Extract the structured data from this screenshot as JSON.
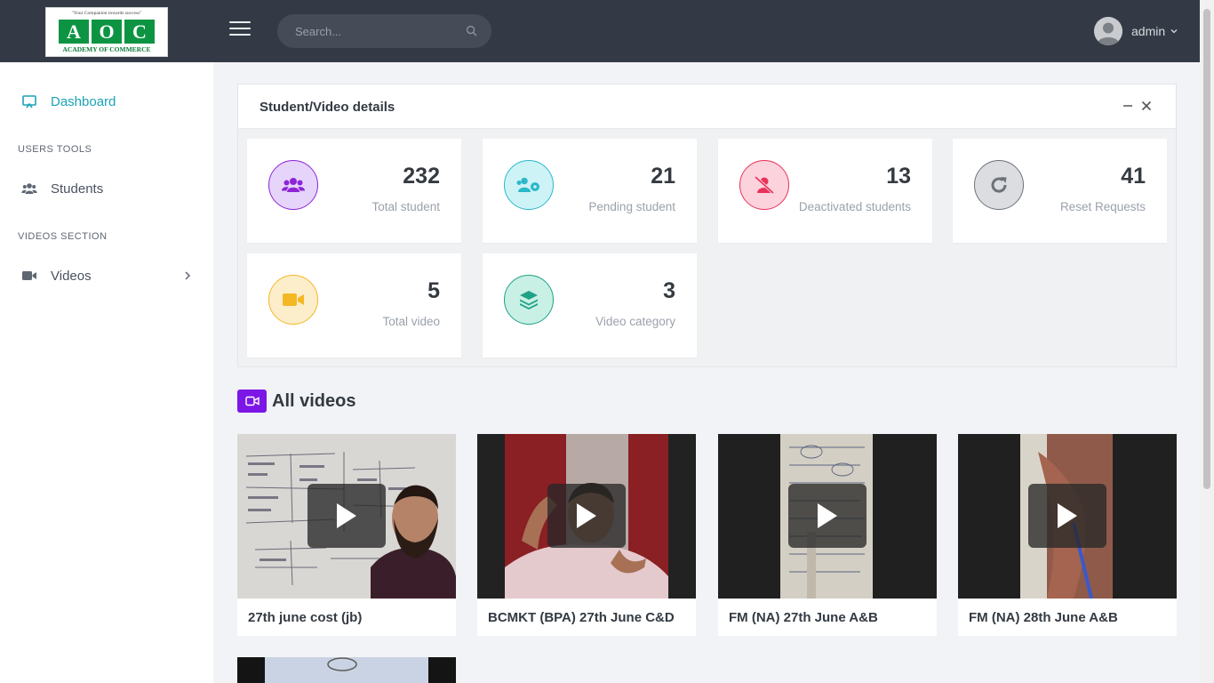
{
  "header": {
    "logo": {
      "tagline": "\"Your Companion towards success\"",
      "letters": [
        "A",
        "O",
        "C"
      ],
      "name": "ACADEMY OF COMMERCE"
    },
    "search_placeholder": "Search...",
    "user_name": "admin"
  },
  "sidebar": {
    "dashboard": "Dashboard",
    "section_users": "USERS TOOLS",
    "students": "Students",
    "section_videos": "VIDEOS SECTION",
    "videos": "Videos"
  },
  "panel": {
    "title": "Student/Video details",
    "cards": [
      {
        "value": "232",
        "label": "Total student",
        "icon": "users-icon",
        "color": "#8e24d6"
      },
      {
        "value": "21",
        "label": "Pending student",
        "icon": "users-cog-icon",
        "color": "#2bb8c9"
      },
      {
        "value": "13",
        "label": "Deactivated students",
        "icon": "user-slash-icon",
        "color": "#e8325b"
      },
      {
        "value": "41",
        "label": "Reset Requests",
        "icon": "refresh-icon",
        "color": "#6c727a"
      },
      {
        "value": "5",
        "label": "Total video",
        "icon": "video-icon",
        "color": "#f3b824"
      },
      {
        "value": "3",
        "label": "Video category",
        "icon": "layers-icon",
        "color": "#1fa287"
      }
    ]
  },
  "videos_section": {
    "title": "All videos",
    "items": [
      {
        "title": "27th june cost (jb)"
      },
      {
        "title": "BCMKT (BPA) 27th June C&D"
      },
      {
        "title": "FM (NA) 27th June A&B"
      },
      {
        "title": "FM (NA) 28th June A&B"
      }
    ]
  },
  "colors": {
    "header_bg": "#343a45",
    "accent": "#1aa3b5",
    "section_icon": "#7c16e6"
  }
}
